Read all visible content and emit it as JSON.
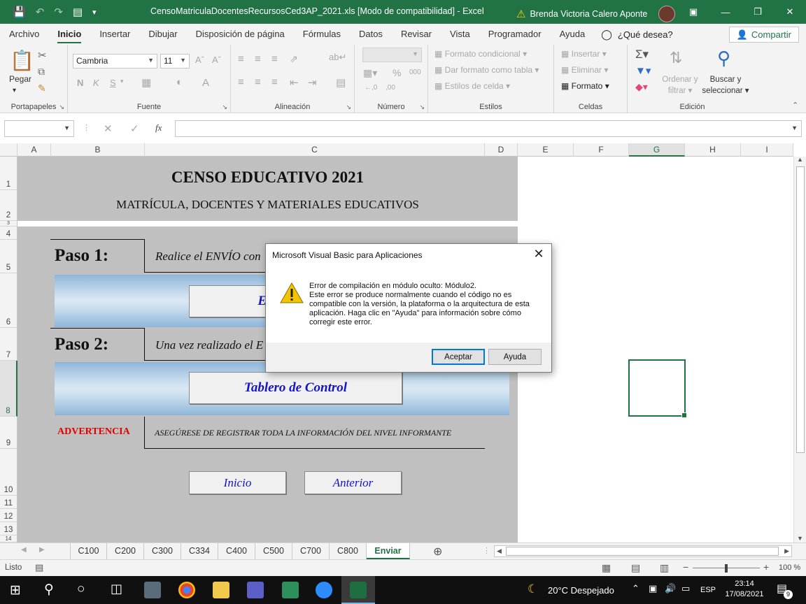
{
  "window": {
    "title": "CensoMatriculaDocentesRecursosCed3AP_2021.xls  [Modo de compatibilidad]  -  Excel",
    "user": "Brenda Victoria Calero Aponte",
    "accent": "#217346"
  },
  "ribbon_tabs": [
    "Archivo",
    "Inicio",
    "Insertar",
    "Dibujar",
    "Disposición de página",
    "Fórmulas",
    "Datos",
    "Revisar",
    "Vista",
    "Programador",
    "Ayuda"
  ],
  "tell_me": "¿Qué desea?",
  "share_label": "Compartir",
  "ribbon": {
    "paste": "Pegar",
    "font_name": "Cambria",
    "font_size": "11",
    "bold": "N",
    "italic": "K",
    "underline": "S",
    "conditional": "Formato condicional",
    "as_table": "Dar formato como tabla",
    "cell_styles": "Estilos de celda",
    "insert": "Insertar",
    "delete": "Eliminar",
    "format": "Formato",
    "sort_1": "Ordenar y",
    "sort_2": "filtrar",
    "find_1": "Buscar y",
    "find_2": "seleccionar",
    "groups": [
      "Portapapeles",
      "Fuente",
      "Alineación",
      "Número",
      "Estilos",
      "Celdas",
      "Edición"
    ]
  },
  "columns": [
    "A",
    "B",
    "C",
    "D",
    "E",
    "F",
    "G",
    "H",
    "I"
  ],
  "selected_column": "G",
  "rows": [
    "1",
    "2",
    "3",
    "4",
    "5",
    "6",
    "7",
    "8",
    "9",
    "10",
    "11",
    "12",
    "13",
    "14"
  ],
  "sheet": {
    "heading": "CENSO EDUCATIVO 2021",
    "subheading": "MATRÍCULA, DOCENTES Y MATERIALES EDUCATIVOS",
    "step1_label": "Paso 1:",
    "step1_text": "Realice el ENVÍO con",
    "step1_button": "E",
    "step2_label": "Paso 2:",
    "step2_text": "Una vez realizado el E",
    "step2_button": "Tablero de Control",
    "warning_label": "ADVERTENCIA",
    "warning_text": "ASEGÚRESE DE REGISTRAR TODA LA INFORMACIÓN DEL NIVEL INFORMANTE",
    "nav_home": "Inicio",
    "nav_prev": "Anterior"
  },
  "sheet_tabs": [
    "C100",
    "C200",
    "C300",
    "C334",
    "C400",
    "C500",
    "C700",
    "C800",
    "Enviar"
  ],
  "active_sheet": "Enviar",
  "status": {
    "ready": "Listo",
    "zoom": "100 %"
  },
  "dialog": {
    "title": "Microsoft Visual Basic para Aplicaciones",
    "message": "Error de compilación en módulo oculto:  Módulo2.\nEste error se produce normalmente cuando el código no es compatible con la versión, la plataforma o la arquitectura de esta aplicación.  Haga clic en \"Ayuda\" para información sobre cómo corregir este error.",
    "ok": "Aceptar",
    "help": "Ayuda"
  },
  "taskbar": {
    "weather": "20°C  Despejado",
    "lang": "ESP",
    "time": "23:14",
    "date": "17/08/2021",
    "notifications": "9"
  }
}
